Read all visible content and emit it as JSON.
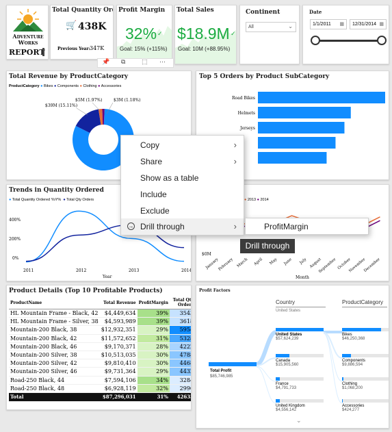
{
  "logo": {
    "line1": "Adventure",
    "line2": "Works",
    "report": "REPORT"
  },
  "kpi_qty": {
    "title": "Total Quantity Ordered",
    "value": "438K",
    "prev_label": "Previous Year:",
    "prev_value": "347K"
  },
  "kpi_margin": {
    "title": "Profit Margin",
    "value": "32%",
    "goal": "Goal: 15% (+115%)"
  },
  "kpi_sales": {
    "title": "Total Sales",
    "value": "$18.9M",
    "goal": "Goal: 10M (+88.95%)"
  },
  "filter_continent": {
    "label": "Continent",
    "value": "All"
  },
  "filter_date": {
    "label": "Date",
    "start": "1/1/2011",
    "end": "12/31/2014"
  },
  "visual_toolbar": {
    "pin": "pin-icon",
    "copy": "copy-visual-icon",
    "focus": "focus-mode-icon",
    "more": "more-options-icon"
  },
  "revenue_chart": {
    "title": "Total Revenue by ProductCategory",
    "legend_label": "ProductCategory",
    "legend": [
      "Bikes",
      "Components",
      "Clothing",
      "Accessories"
    ],
    "colors": {
      "bikes": "#118dff",
      "components": "#12239e",
      "clothing": "#e66c37",
      "accessories": "#6b007b"
    },
    "labels": {
      "components": "$5M (1.97%)",
      "bikes_small": "$3M (1.18%)",
      "comp_big": "$39M (15.11%)"
    }
  },
  "top_orders": {
    "title": "Top 5 Orders by Product SubCategory",
    "categories": [
      "Road Bikes",
      "Helmets",
      "Jerseys",
      "",
      ""
    ]
  },
  "trends": {
    "title": "Trends in Quantity Ordered",
    "legend": [
      "Total Quantity Ordered YoY%",
      "Total Qty Orders"
    ],
    "y_ticks": [
      "400%",
      "200%",
      "0%"
    ],
    "x_ticks": [
      "2011",
      "2012",
      "2013",
      "2014"
    ],
    "x_title": "Year"
  },
  "monthly": {
    "legend": [
      "2013",
      "2014"
    ],
    "y_tick": "$0M",
    "months": [
      "January",
      "February",
      "March",
      "April",
      "May",
      "June",
      "July",
      "August",
      "September",
      "October",
      "November",
      "December"
    ],
    "x_title": "Month"
  },
  "products": {
    "title": "Product Details (Top 10 Profitable Products)",
    "headers": [
      "ProductName",
      "Total Revenue",
      "ProfitMargin",
      "Total Qty Orders"
    ],
    "rows": [
      {
        "name": "HL Mountain Frame - Black, 42",
        "rev": "$4,449,634",
        "pm": "39%",
        "qty": "3543"
      },
      {
        "name": "HL Mountain Frame - Silver, 38",
        "rev": "$4,593,989",
        "pm": "39%",
        "qty": "3618"
      },
      {
        "name": "Mountain-200 Black, 38",
        "rev": "$12,932,351",
        "pm": "29%",
        "qty": "5954"
      },
      {
        "name": "Mountain-200 Black, 42",
        "rev": "$11,572,652",
        "pm": "31%",
        "qty": "5328"
      },
      {
        "name": "Mountain-200 Black, 46",
        "rev": "$9,170,371",
        "pm": "28%",
        "qty": "4222"
      },
      {
        "name": "Mountain-200 Silver, 38",
        "rev": "$10,513,035",
        "pm": "30%",
        "qty": "4788"
      },
      {
        "name": "Mountain-200 Silver, 42",
        "rev": "$9,810,410",
        "pm": "30%",
        "qty": "4468"
      },
      {
        "name": "Mountain-200 Silver, 46",
        "rev": "$9,731,364",
        "pm": "29%",
        "qty": "4432"
      },
      {
        "name": "Road-250 Black, 44",
        "rev": "$7,594,106",
        "pm": "34%",
        "qty": "3284"
      },
      {
        "name": "Road-250 Black, 48",
        "rev": "$6,928,119",
        "pm": "32%",
        "qty": "2996"
      }
    ],
    "total": {
      "name": "Total",
      "rev": "$87,296,031",
      "pm": "31%",
      "qty": "42633"
    }
  },
  "profit_factors": {
    "title": "Profit Factors",
    "col1_header": "Country",
    "col1_sub": "United States",
    "col2_header": "ProductCategory",
    "root": {
      "label": "Total Profit",
      "value": "$85,746,985"
    },
    "countries": [
      {
        "label": "United States",
        "value": "$57,624,239"
      },
      {
        "label": "Canada",
        "value": "$15,905,560"
      },
      {
        "label": "France",
        "value": "$4,791,733"
      },
      {
        "label": "United Kingdom",
        "value": "$4,556,142"
      }
    ],
    "categories": [
      {
        "label": "Bikes",
        "value": "$46,250,368"
      },
      {
        "label": "Components",
        "value": "$9,886,594"
      },
      {
        "label": "Clothing",
        "value": "$1,068,200"
      },
      {
        "label": "Accessories",
        "value": "$424,277"
      }
    ]
  },
  "context_menu": {
    "items": [
      {
        "label": "Copy",
        "submenu": true
      },
      {
        "label": "Share",
        "submenu": true
      },
      {
        "label": "Show as a table",
        "submenu": false
      },
      {
        "label": "Include",
        "submenu": false
      },
      {
        "label": "Exclude",
        "submenu": false
      },
      {
        "label": "Drill through",
        "submenu": true
      }
    ],
    "submenu_item": "ProfitMargin",
    "tooltip": "Drill through"
  },
  "chart_data": [
    {
      "type": "pie",
      "title": "Total Revenue by ProductCategory",
      "categories": [
        "Bikes",
        "Components",
        "Clothing",
        "Accessories"
      ],
      "values": [
        81.74,
        15.11,
        1.97,
        1.18
      ],
      "value_labels": [
        "",
        "$39M (15.11%)",
        "$5M (1.97%)",
        "$3M (1.18%)"
      ],
      "legend_position": "top-left"
    },
    {
      "type": "bar",
      "orientation": "horizontal",
      "title": "Top 5 Orders by Product SubCategory",
      "categories": [
        "Road Bikes",
        "Helmets",
        "Jerseys",
        "",
        ""
      ],
      "values": [
        100,
        73,
        68,
        61,
        54
      ]
    },
    {
      "type": "line",
      "title": "Trends in Quantity Ordered",
      "x": [
        "2011",
        "2012",
        "2013",
        "2014"
      ],
      "series": [
        {
          "name": "Total Quantity Ordered YoY%",
          "values": [
            -5,
            440,
            200,
            0
          ]
        },
        {
          "name": "Total Qty Orders",
          "values": [
            0,
            230,
            320,
            120
          ]
        }
      ],
      "ylim": [
        -20,
        460
      ],
      "xlabel": "Year"
    },
    {
      "type": "line",
      "title": "",
      "x": [
        "January",
        "February",
        "March",
        "April",
        "May",
        "June",
        "July",
        "August",
        "September",
        "October",
        "November",
        "December"
      ],
      "series": [
        {
          "name": "2013",
          "values": [
            2.6,
            2.1,
            2.4,
            2.7,
            2.5,
            3.0,
            2.6,
            2.3,
            2.4,
            2.5,
            2.3,
            2.9
          ]
        },
        {
          "name": "2014",
          "values": [
            2.2,
            1.9,
            2.2,
            2.4,
            2.3,
            2.8,
            2.3,
            2.0,
            2.1,
            2.2,
            2.0,
            2.6
          ]
        }
      ],
      "xlabel": "Month"
    }
  ]
}
